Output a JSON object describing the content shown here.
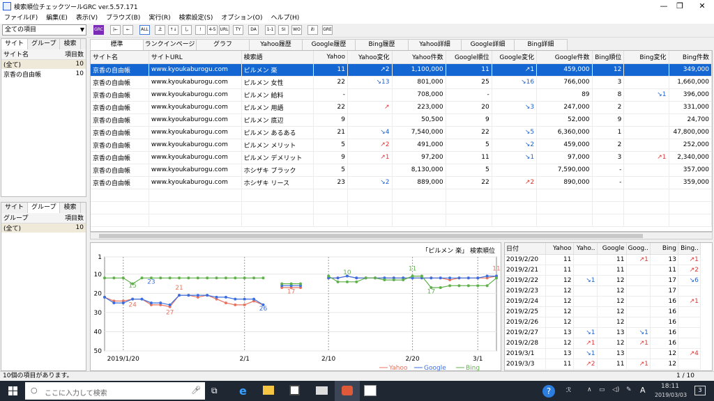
{
  "window": {
    "title": "検索順位チェックツールGRC  ver.5.57.171",
    "minimize": "—",
    "maximize": "❐",
    "close": "✕"
  },
  "menu": [
    "ファイル(F)",
    "編集(E)",
    "表示(V)",
    "ブラウズ(B)",
    "実行(R)",
    "検索設定(S)",
    "オプション(O)",
    "ヘルプ(H)"
  ],
  "filter": {
    "selected": "全ての項目"
  },
  "toolbar_buttons": [
    "GRC",
    "|←",
    "←",
    "ALL",
    "上",
    "↑↓",
    "し",
    "!",
    "4-5",
    "URL",
    "TY PE",
    "DA TA",
    "1-1",
    "SI TE",
    "WO RD",
    "お",
    "GRE UP"
  ],
  "left_top": {
    "tabs": [
      "サイト",
      "グループ",
      "検索"
    ],
    "headers": [
      "サイト名",
      "項目数"
    ],
    "rows": [
      {
        "name": "(全て)",
        "count": "10"
      },
      {
        "name": "京香の自由帳",
        "count": "10"
      }
    ]
  },
  "left_bottom": {
    "tabs": [
      "サイト",
      "グループ",
      "検索"
    ],
    "headers": [
      "グループ",
      "項目数"
    ],
    "rows": [
      {
        "name": "(全て)",
        "count": "10"
      }
    ]
  },
  "main_tabs": [
    "標準",
    "ランクインページ",
    "グラフ",
    "Yahoo履歴",
    "Google履歴",
    "Bing履歴",
    "Yahoo詳細",
    "Google詳細",
    "Bing詳細"
  ],
  "grid": {
    "headers": [
      "サイト名",
      "サイトURL",
      "検索語",
      "Yahoo",
      "Yahoo変化",
      "Yahoo件数",
      "Google順位",
      "Google変化",
      "Google件数",
      "Bing順位",
      "Bing変化",
      "Bing件数"
    ],
    "rows": [
      [
        "京香の自由帳",
        "www.kyoukaburogu.com",
        "ピルメン 楽",
        "11",
        "↗2",
        "1,100,000",
        "11",
        "↗1",
        "459,000",
        "12",
        "",
        "349,000"
      ],
      [
        "京香の自由帳",
        "www.kyoukaburogu.com",
        "ピルメン 女性",
        "22",
        "↘13",
        "801,000",
        "25",
        "↘16",
        "766,000",
        "3",
        "",
        "1,660,000"
      ],
      [
        "京香の自由帳",
        "www.kyoukaburogu.com",
        "ピルメン 給料",
        "-",
        "",
        "708,000",
        "-",
        "",
        "89",
        "8",
        "↘1",
        "396,000"
      ],
      [
        "京香の自由帳",
        "www.kyoukaburogu.com",
        "ピルメン 用語",
        "22",
        "↗",
        "223,000",
        "20",
        "↘3",
        "247,000",
        "2",
        "",
        "331,000"
      ],
      [
        "京香の自由帳",
        "www.kyoukaburogu.com",
        "ピルメン 底辺",
        "9",
        "",
        "50,500",
        "9",
        "",
        "52,000",
        "9",
        "",
        "24,700"
      ],
      [
        "京香の自由帳",
        "www.kyoukaburogu.com",
        "ピルメン あるある",
        "21",
        "↘4",
        "7,540,000",
        "22",
        "↘5",
        "6,360,000",
        "1",
        "",
        "47,800,000"
      ],
      [
        "京香の自由帳",
        "www.kyoukaburogu.com",
        "ピルメン メリット",
        "5",
        "↗2",
        "491,000",
        "5",
        "↘2",
        "459,000",
        "2",
        "",
        "252,000"
      ],
      [
        "京香の自由帳",
        "www.kyoukaburogu.com",
        "ピルメン デメリット",
        "9",
        "↗1",
        "97,200",
        "11",
        "↘1",
        "97,000",
        "3",
        "↗1",
        "2,340,000"
      ],
      [
        "京香の自由帳",
        "www.kyoukaburogu.com",
        "ホシザキ ブラック",
        "5",
        "",
        "8,130,000",
        "5",
        "",
        "7,590,000",
        "-",
        "",
        "357,000"
      ],
      [
        "京香の自由帳",
        "www.kyoukaburogu.com",
        "ホシザキ リース",
        "23",
        "↘2",
        "889,000",
        "22",
        "↗2",
        "890,000",
        "-",
        "",
        "359,000"
      ]
    ]
  },
  "chart_data": {
    "type": "line",
    "title": "「ピルメン 楽」 検索順位",
    "ylim": [
      1,
      50
    ],
    "yticks": [
      "1",
      "10",
      "20",
      "30",
      "40",
      "50"
    ],
    "xticks": [
      "2019/1/20",
      "2/1",
      "2/10",
      "2/20",
      "3/1"
    ],
    "x": [
      0,
      1,
      2,
      3,
      4,
      5,
      6,
      7,
      8,
      9,
      10,
      11,
      12,
      13,
      14,
      15,
      16,
      17,
      18,
      19,
      20,
      21,
      22,
      23,
      24,
      25,
      26,
      27,
      28,
      29,
      30,
      31,
      32,
      33,
      34,
      35,
      36,
      37,
      38,
      39,
      40,
      41,
      42
    ],
    "series": [
      {
        "name": "Yahoo",
        "color": "#e8735f",
        "values": [
          22,
          24,
          24,
          23,
          23,
          26,
          26,
          27,
          21,
          21,
          22,
          21,
          23,
          25,
          26,
          26,
          24,
          26,
          null,
          17,
          17,
          17,
          null,
          null,
          12,
          12,
          11,
          12,
          12,
          12,
          12,
          12,
          12,
          12,
          12,
          12,
          12,
          13,
          12,
          12,
          12,
          12,
          11
        ]
      },
      {
        "name": "Google",
        "color": "#3a6fe0",
        "values": [
          22,
          25,
          25,
          23,
          23,
          25,
          25,
          26,
          21,
          21,
          21,
          21,
          22,
          22,
          23,
          23,
          23,
          26,
          null,
          16,
          16,
          16,
          null,
          null,
          12,
          12,
          11,
          12,
          12,
          12,
          12,
          12,
          12,
          12,
          12,
          12,
          12,
          12,
          12,
          12,
          12,
          11,
          11
        ]
      },
      {
        "name": "Bing",
        "color": "#5fb04a",
        "values": [
          12,
          12,
          12,
          15,
          12,
          12,
          12,
          12,
          12,
          12,
          12,
          12,
          12,
          12,
          12,
          12,
          12,
          12,
          null,
          15,
          15,
          15,
          null,
          null,
          11,
          14,
          14,
          14,
          12,
          12,
          13,
          13,
          13,
          11,
          11,
          17,
          17,
          16,
          16,
          16,
          16,
          16,
          12
        ]
      }
    ],
    "annotations": [
      "15",
      "23",
      "24",
      "27",
      "21",
      "26",
      "17",
      "10",
      "11",
      "17",
      "11"
    ]
  },
  "date_table": {
    "headers": [
      "日付",
      "Yahoo",
      "Yaho..",
      "Google",
      "Goog..",
      "Bing",
      "Bing.."
    ],
    "rows": [
      [
        "2019/2/20",
        "11",
        "",
        "11",
        "↗1",
        "13",
        "↗1"
      ],
      [
        "2019/2/21",
        "11",
        "",
        "11",
        "",
        "11",
        "↗2"
      ],
      [
        "2019/2/22",
        "12",
        "↘1",
        "12",
        "",
        "17",
        "↘6"
      ],
      [
        "2019/2/23",
        "12",
        "",
        "12",
        "",
        "17",
        ""
      ],
      [
        "2019/2/24",
        "12",
        "",
        "12",
        "",
        "16",
        "↗1"
      ],
      [
        "2019/2/25",
        "12",
        "",
        "12",
        "",
        "16",
        ""
      ],
      [
        "2019/2/26",
        "12",
        "",
        "12",
        "",
        "16",
        ""
      ],
      [
        "2019/2/27",
        "13",
        "↘1",
        "13",
        "↘1",
        "16",
        ""
      ],
      [
        "2019/2/28",
        "12",
        "↗1",
        "12",
        "↗1",
        "16",
        ""
      ],
      [
        "2019/3/1",
        "13",
        "↘1",
        "13",
        "",
        "12",
        "↗4"
      ],
      [
        "2019/3/3",
        "11",
        "↗2",
        "11",
        "↗1",
        "12",
        ""
      ]
    ]
  },
  "status": {
    "text": "10個の項目があります。",
    "page": "1 / 10"
  },
  "taskbar": {
    "search": "ここに入力して検索",
    "time": "18:11",
    "date": "2019/03/03",
    "ime": "A",
    "notif": "3"
  }
}
